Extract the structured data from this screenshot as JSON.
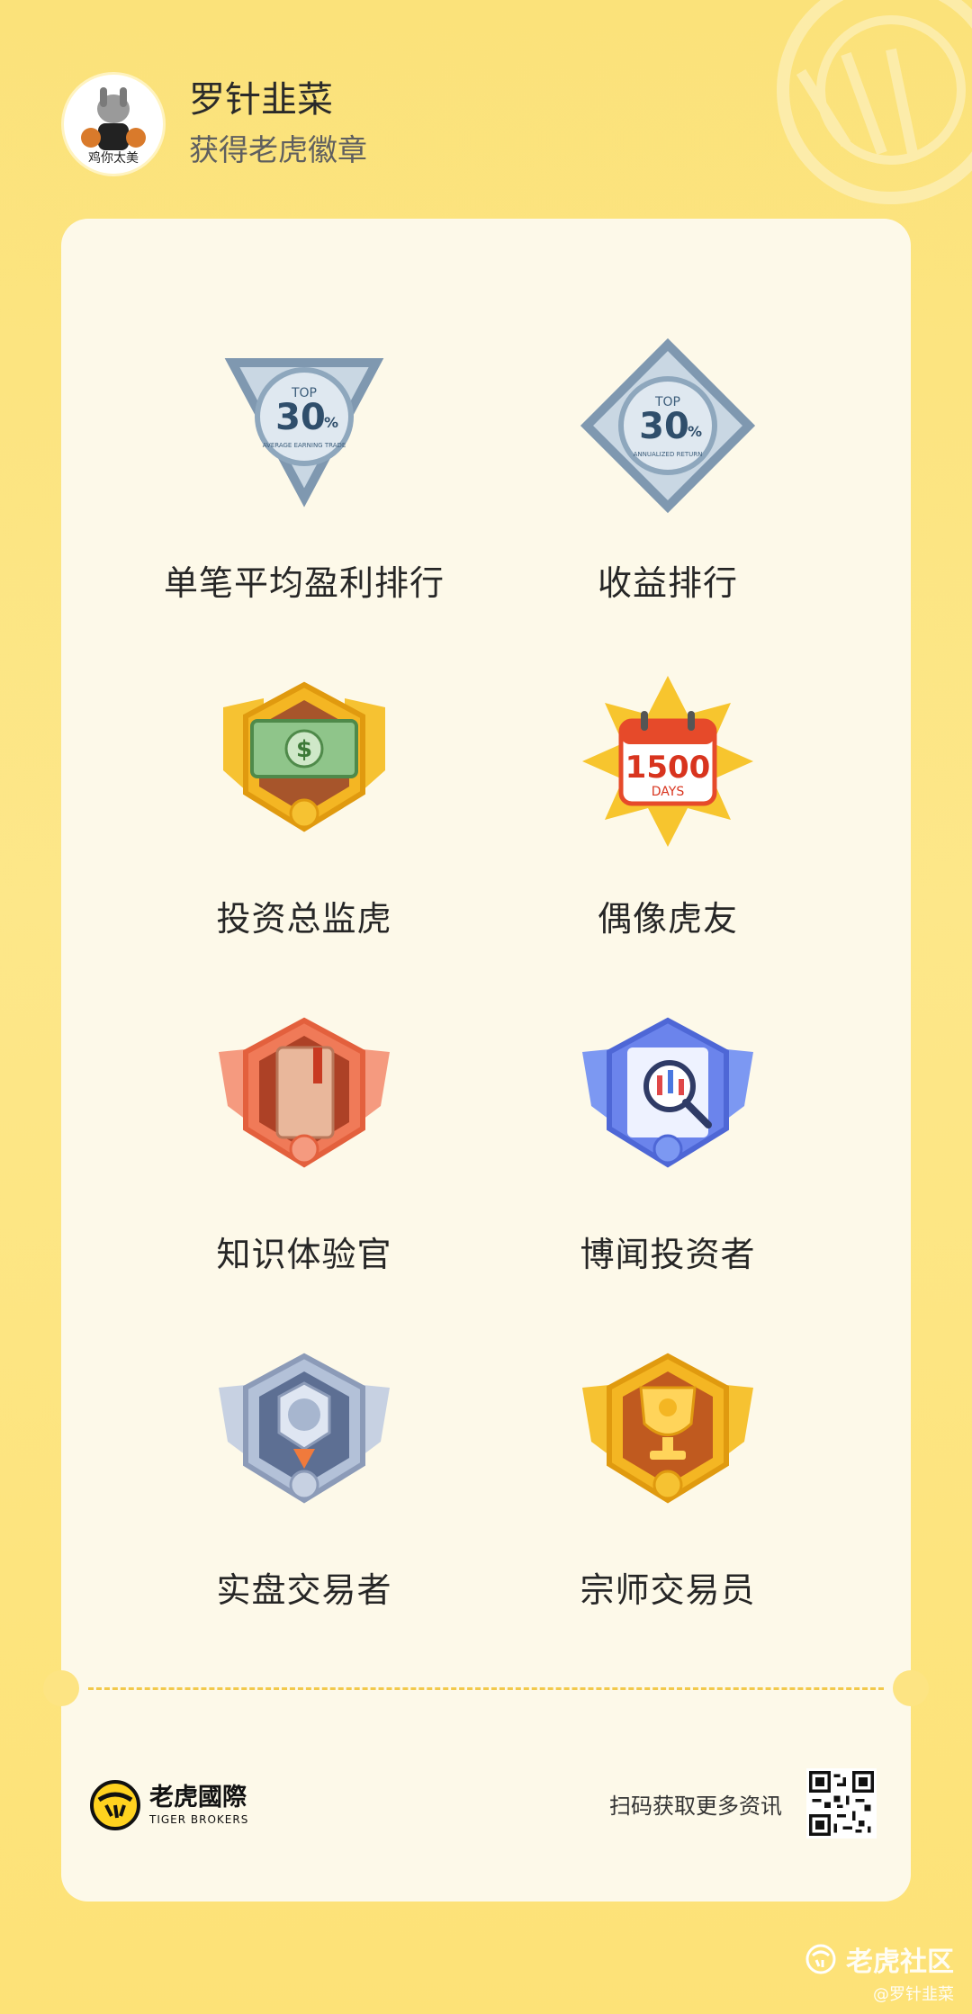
{
  "profile": {
    "avatar_caption": "鸡你太美",
    "username": "罗针韭菜",
    "subtitle": "获得老虎徽章"
  },
  "badges": [
    {
      "label": "单笔平均盈利排行",
      "icon": "silver-triangle-top30-icon",
      "texts": [
        "TOP",
        "30",
        "%",
        "AVERAGE EARNING TRADE"
      ]
    },
    {
      "label": "收益排行",
      "icon": "silver-diamond-top30-icon",
      "texts": [
        "TOP",
        "30",
        "%",
        "ANNUALIZED RETURN"
      ]
    },
    {
      "label": "投资总监虎",
      "icon": "gold-money-badge-icon",
      "texts": [
        "$"
      ]
    },
    {
      "label": "偶像虎友",
      "icon": "calendar-1500-days-badge-icon",
      "texts": [
        "1500",
        "DAYS"
      ]
    },
    {
      "label": "知识体验官",
      "icon": "orange-book-badge-icon",
      "texts": []
    },
    {
      "label": "博闻投资者",
      "icon": "blue-chart-magnifier-badge-icon",
      "texts": []
    },
    {
      "label": "实盘交易者",
      "icon": "silver-medal-badge-icon",
      "texts": []
    },
    {
      "label": "宗师交易员",
      "icon": "gold-trophy-badge-icon",
      "texts": []
    }
  ],
  "footer": {
    "brand_cn": "老虎國際",
    "brand_en": "TIGER BROKERS",
    "scan_text": "扫码获取更多资讯",
    "qr_icon": "qr-code-icon"
  },
  "watermark": {
    "text": "老虎社区",
    "handle": "@罗针韭菜"
  },
  "colors": {
    "background": "#fde27a",
    "card": "#fdf9e9",
    "dash": "#f2c94c"
  }
}
